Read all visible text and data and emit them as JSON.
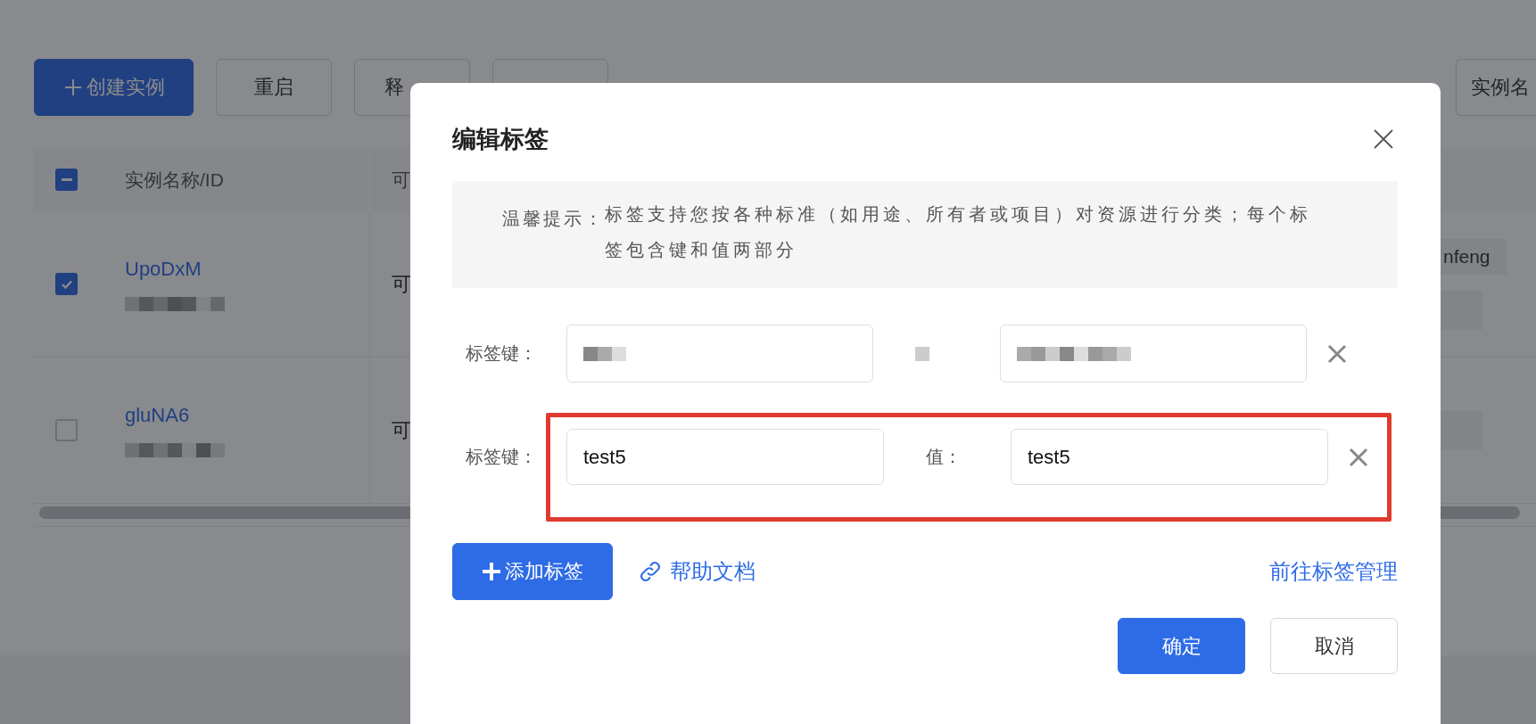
{
  "toolbar": {
    "buttons": [
      {
        "label": "创建实例",
        "kind": "primary"
      },
      {
        "label": "重启",
        "kind": "default"
      },
      {
        "label": "释",
        "kind": "default"
      },
      {
        "kind": "default"
      }
    ],
    "search_button": {
      "label": "实例名"
    }
  },
  "table": {
    "header": {
      "indeterminate": true,
      "columns": [
        "实例名称/ID",
        "可"
      ]
    },
    "rows": [
      {
        "selected": true,
        "name": "UpoDxM",
        "column_2": "可",
        "tag": "nfeng"
      },
      {
        "selected": false,
        "name": "gluNA6",
        "column_2": "可"
      }
    ]
  },
  "dialog": {
    "title": "编辑标签",
    "tip": {
      "label": "温馨提示：",
      "text": "标签支持您按各种标准（如用途、所有者或项目）对资源进行分类；每个标签包含键和值两部分"
    },
    "tags": [
      {
        "key_label": "标签键：",
        "redacted": true,
        "highlighted": false
      },
      {
        "key_label": "标签键：",
        "key": "test5",
        "value_label": "值：",
        "value": "test5",
        "redacted": false,
        "highlighted": true
      }
    ],
    "add_button": "添加标签",
    "help_link": "帮助文档",
    "manage_link": "前往标签管理",
    "buttons": [
      {
        "label": "确定",
        "kind": "primary"
      },
      {
        "label": "取消",
        "kind": "default"
      }
    ]
  }
}
